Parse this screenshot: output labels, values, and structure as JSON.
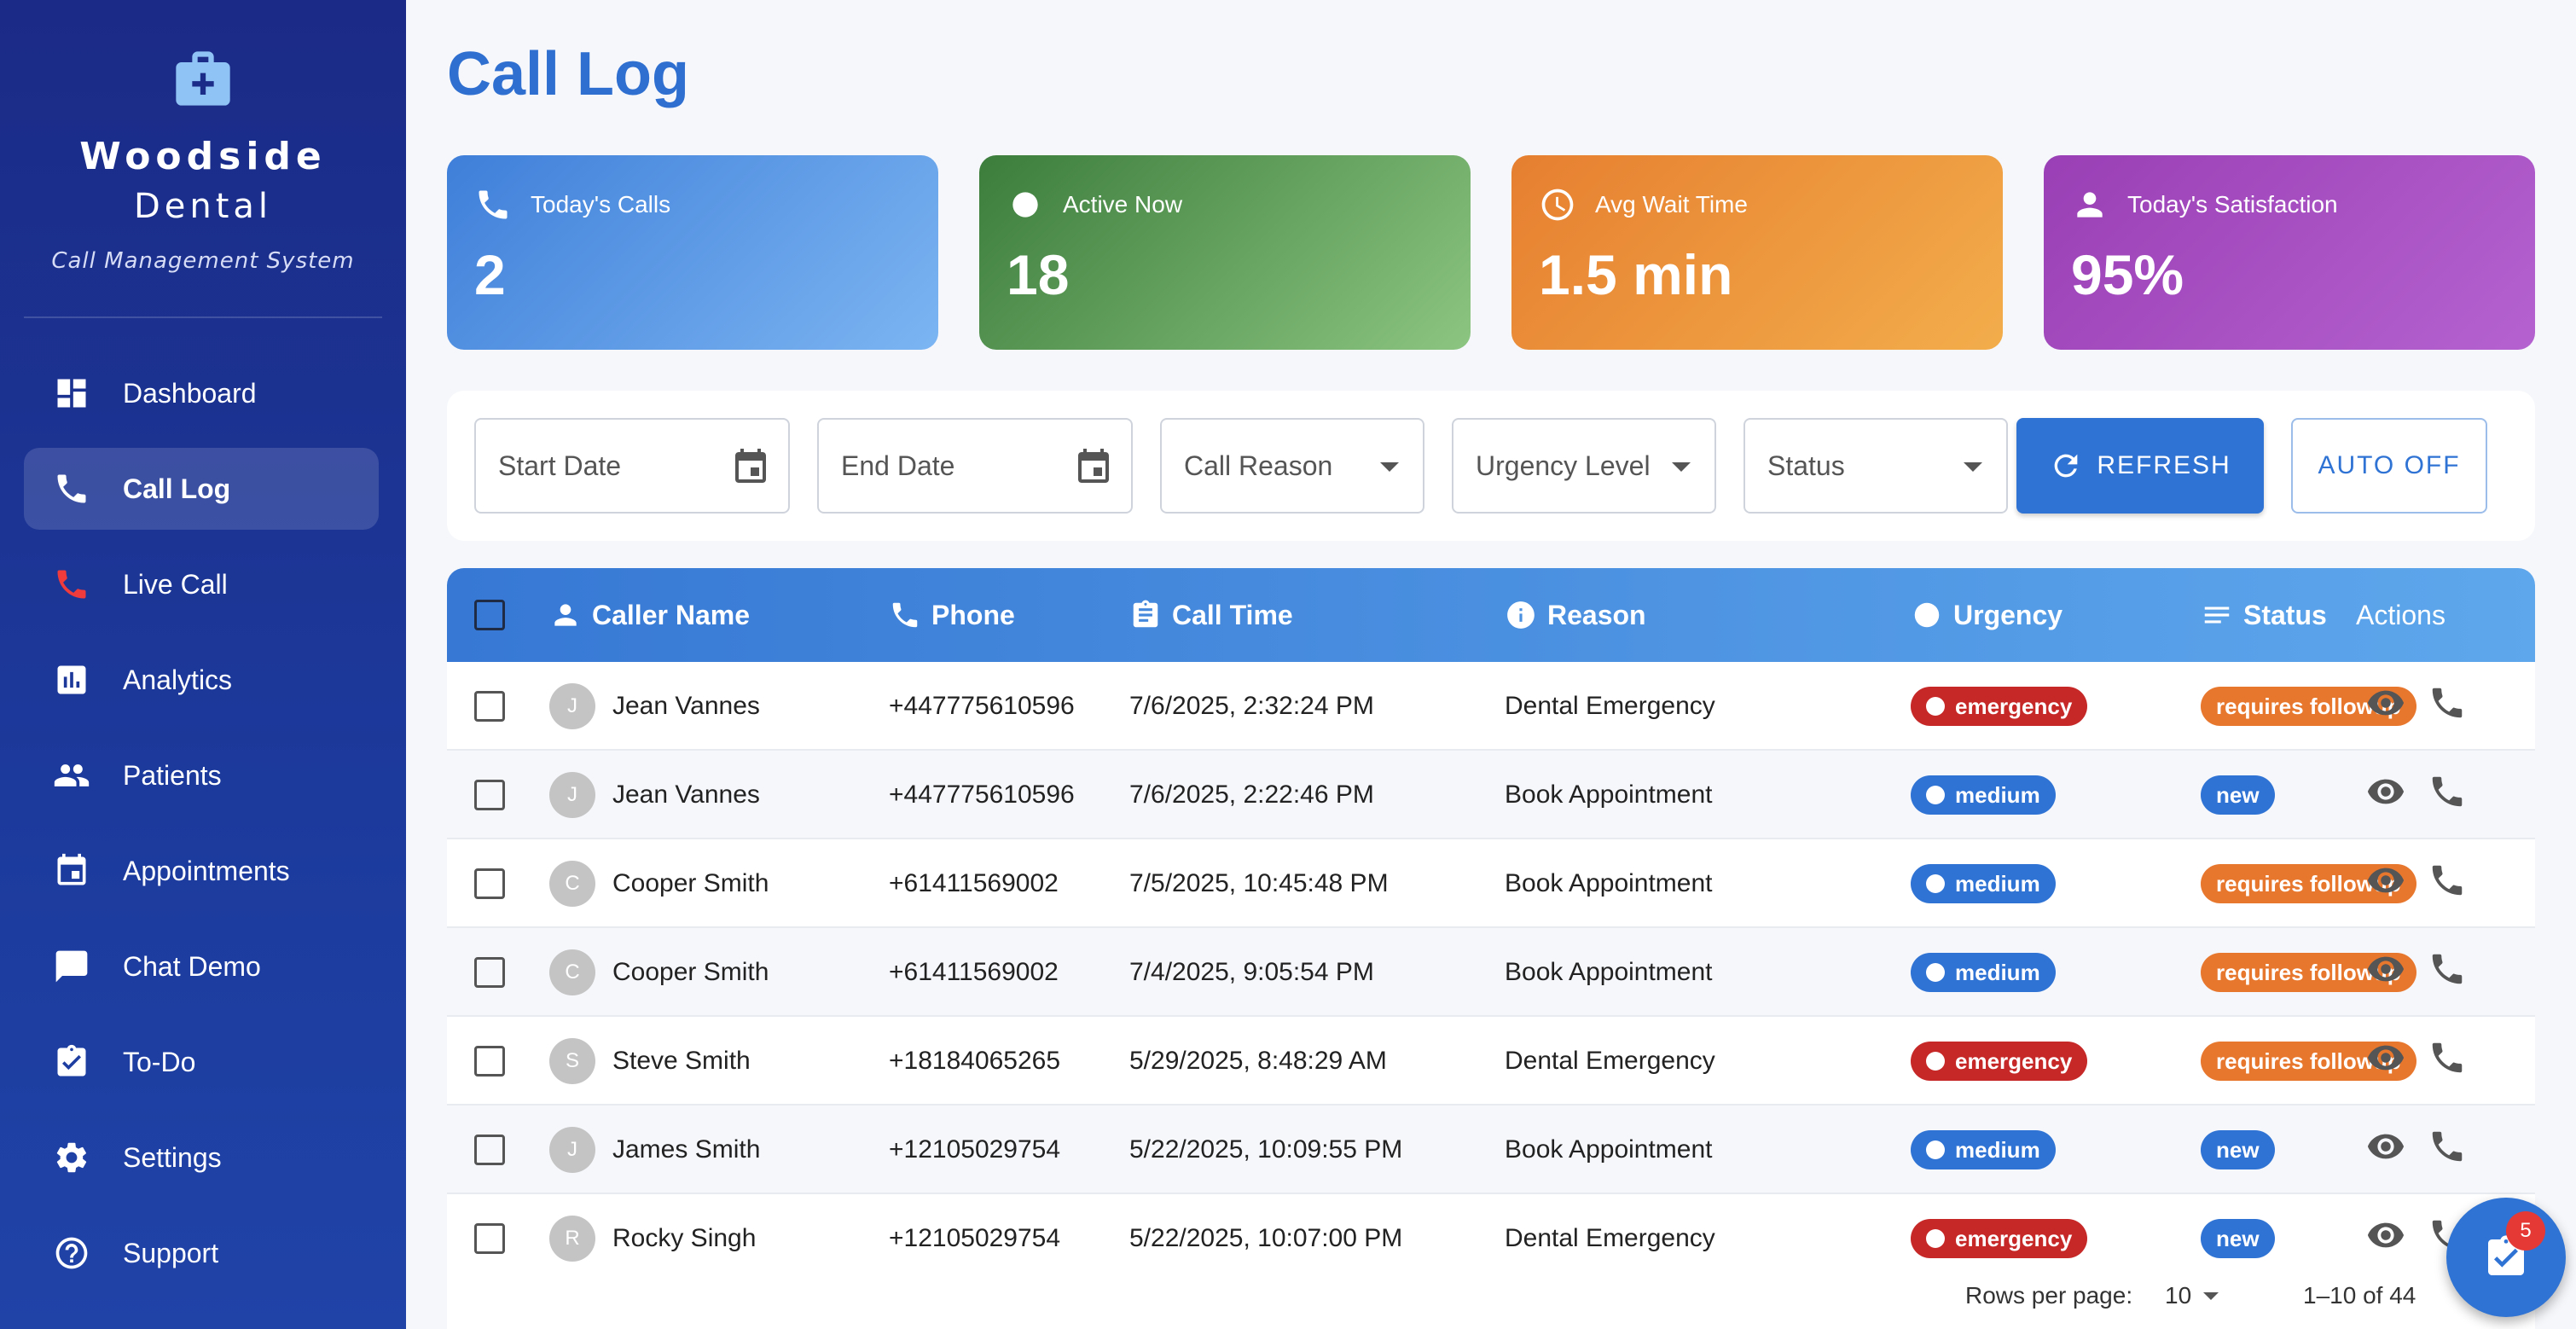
{
  "brand": {
    "name": "Woodside",
    "sub": "Dental",
    "tagline": "Call Management System"
  },
  "nav": [
    {
      "label": "Dashboard",
      "icon": "dashboard-icon"
    },
    {
      "label": "Call Log",
      "icon": "phone-icon",
      "active": true
    },
    {
      "label": "Live Call",
      "icon": "phone-red-icon"
    },
    {
      "label": "Analytics",
      "icon": "analytics-icon"
    },
    {
      "label": "Patients",
      "icon": "people-icon"
    },
    {
      "label": "Appointments",
      "icon": "calendar-icon"
    },
    {
      "label": "Chat Demo",
      "icon": "chat-icon"
    },
    {
      "label": "To-Do",
      "icon": "checklist-icon"
    },
    {
      "label": "Settings",
      "icon": "gear-icon"
    },
    {
      "label": "Support",
      "icon": "help-icon"
    }
  ],
  "page": {
    "title": "Call Log"
  },
  "stats": [
    {
      "label": "Today's Calls",
      "value": "2",
      "icon": "phone-icon"
    },
    {
      "label": "Active Now",
      "value": "18",
      "icon": "dot-icon"
    },
    {
      "label": "Avg Wait Time",
      "value": "1.5 min",
      "icon": "clock-icon"
    },
    {
      "label": "Today's Satisfaction",
      "value": "95%",
      "icon": "person-icon"
    }
  ],
  "filters": {
    "start_date": "Start Date",
    "end_date": "End Date",
    "call_reason": "Call Reason",
    "urgency_level": "Urgency Level",
    "status": "Status",
    "refresh": "REFRESH",
    "auto": "AUTO OFF"
  },
  "table": {
    "headers": {
      "caller": "Caller Name",
      "phone": "Phone",
      "time": "Call Time",
      "reason": "Reason",
      "urgency": "Urgency",
      "status": "Status",
      "actions": "Actions"
    },
    "rows": [
      {
        "initial": "J",
        "name": "Jean Vannes",
        "phone": "+447775610596",
        "time": "7/6/2025, 2:32:24 PM",
        "reason": "Dental Emergency",
        "urgency": "emergency",
        "status": "requires followup"
      },
      {
        "initial": "J",
        "name": "Jean Vannes",
        "phone": "+447775610596",
        "time": "7/6/2025, 2:22:46 PM",
        "reason": "Book Appointment",
        "urgency": "medium",
        "status": "new"
      },
      {
        "initial": "C",
        "name": "Cooper Smith",
        "phone": "+61411569002",
        "time": "7/5/2025, 10:45:48 PM",
        "reason": "Book Appointment",
        "urgency": "medium",
        "status": "requires followup"
      },
      {
        "initial": "C",
        "name": "Cooper Smith",
        "phone": "+61411569002",
        "time": "7/4/2025, 9:05:54 PM",
        "reason": "Book Appointment",
        "urgency": "medium",
        "status": "requires followup"
      },
      {
        "initial": "S",
        "name": "Steve Smith",
        "phone": "+18184065265",
        "time": "5/29/2025, 8:48:29 AM",
        "reason": "Dental Emergency",
        "urgency": "emergency",
        "status": "requires followup"
      },
      {
        "initial": "J",
        "name": "James Smith",
        "phone": "+12105029754",
        "time": "5/22/2025, 10:09:55 PM",
        "reason": "Book Appointment",
        "urgency": "medium",
        "status": "new"
      },
      {
        "initial": "R",
        "name": "Rocky Singh",
        "phone": "+12105029754",
        "time": "5/22/2025, 10:07:00 PM",
        "reason": "Dental Emergency",
        "urgency": "emergency",
        "status": "new"
      }
    ]
  },
  "pagination": {
    "rows_per_page_label": "Rows per page:",
    "rows_per_page": "10",
    "range": "1–10 of 44"
  },
  "fab": {
    "badge": "5"
  },
  "colors": {
    "emergency": "#c62828",
    "medium": "#2f73d4",
    "followup": "#e8772e",
    "new": "#2f73d4"
  }
}
